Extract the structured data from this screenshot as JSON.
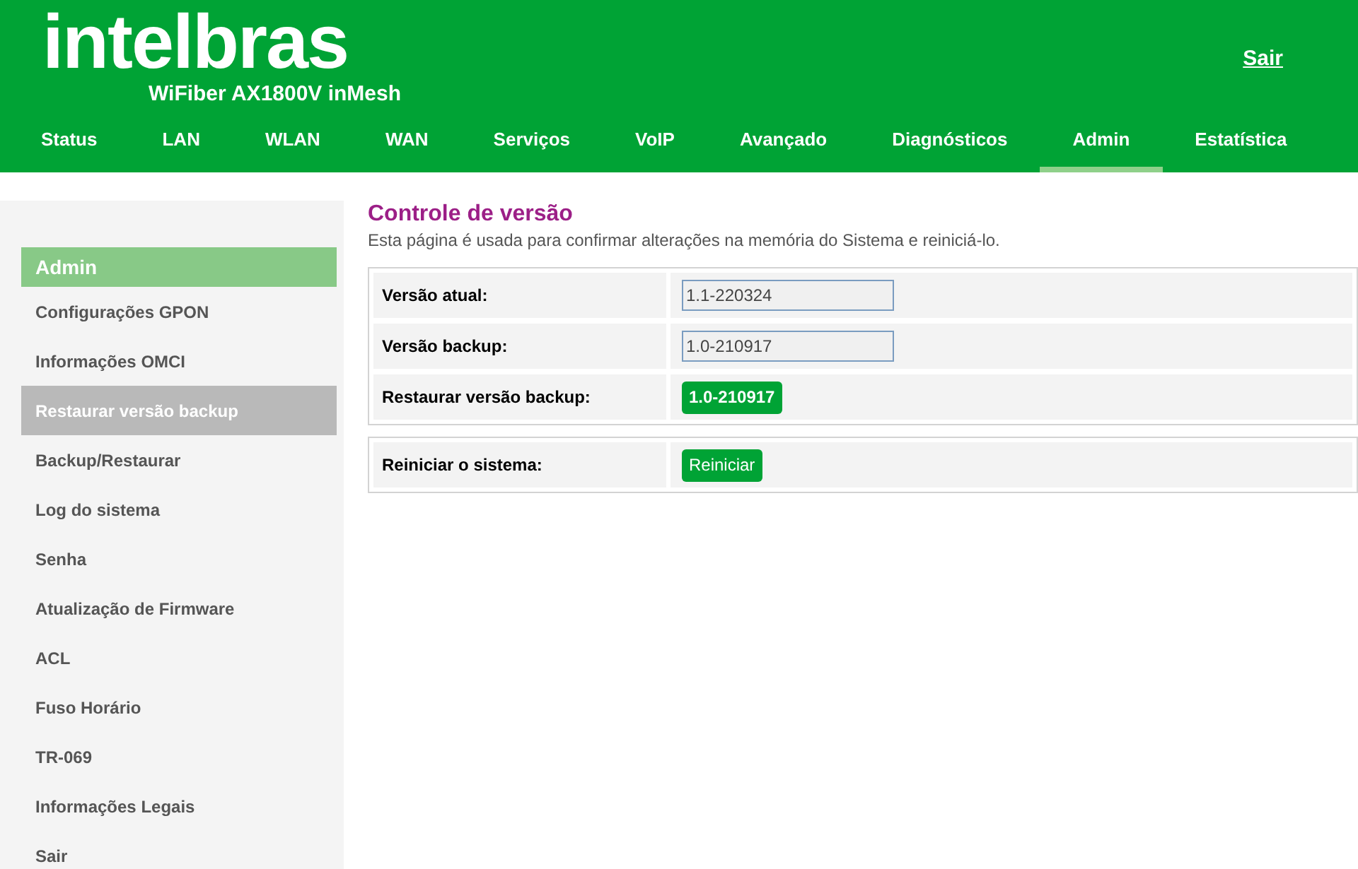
{
  "header": {
    "logo": "intelbras",
    "model": "WiFiber AX1800V inMesh",
    "logout": "Sair"
  },
  "nav": [
    {
      "label": "Status",
      "selected": false
    },
    {
      "label": "LAN",
      "selected": false
    },
    {
      "label": "WLAN",
      "selected": false
    },
    {
      "label": "WAN",
      "selected": false
    },
    {
      "label": "Serviços",
      "selected": false
    },
    {
      "label": "VoIP",
      "selected": false
    },
    {
      "label": "Avançado",
      "selected": false
    },
    {
      "label": "Diagnósticos",
      "selected": false
    },
    {
      "label": "Admin",
      "selected": true
    },
    {
      "label": "Estatística",
      "selected": false
    }
  ],
  "sidebar": {
    "heading": "Admin",
    "items": [
      {
        "label": "Configurações GPON",
        "selected": false
      },
      {
        "label": "Informações OMCI",
        "selected": false
      },
      {
        "label": "Restaurar versão backup",
        "selected": true
      },
      {
        "label": "Backup/Restaurar",
        "selected": false
      },
      {
        "label": "Log do sistema",
        "selected": false
      },
      {
        "label": "Senha",
        "selected": false
      },
      {
        "label": "Atualização de Firmware",
        "selected": false
      },
      {
        "label": "ACL",
        "selected": false
      },
      {
        "label": "Fuso Horário",
        "selected": false
      },
      {
        "label": "TR-069",
        "selected": false
      },
      {
        "label": "Informações Legais",
        "selected": false
      },
      {
        "label": "Sair",
        "selected": false
      }
    ]
  },
  "page": {
    "title": "Controle de versão",
    "description": "Esta página é usada para confirmar alterações na memória do Sistema e reiniciá-lo.",
    "sections": [
      [
        {
          "label": "Versão atual:",
          "kind": "field",
          "value": "1.1-220324"
        },
        {
          "label": "Versão backup:",
          "kind": "field",
          "value": "1.0-210917"
        },
        {
          "label": "Restaurar versão backup:",
          "kind": "button",
          "value": "1.0-210917"
        }
      ],
      [
        {
          "label": "Reiniciar o sistema:",
          "kind": "button",
          "value": "Reiniciar"
        }
      ]
    ]
  }
}
